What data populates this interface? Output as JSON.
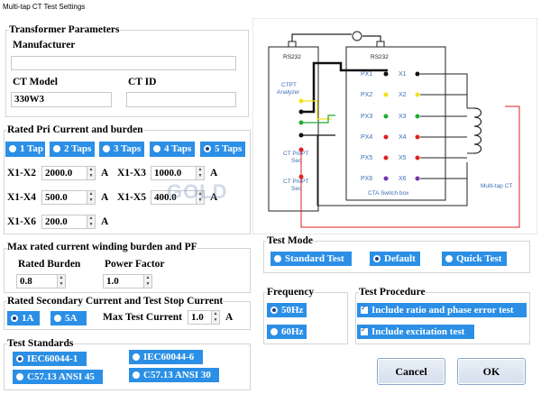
{
  "window": {
    "title": "Multi-tap CT Test Settings"
  },
  "transformer": {
    "title": "Transformer Parameters",
    "manufacturer_label": "Manufacturer",
    "manufacturer_value": "",
    "ct_model_label": "CT Model",
    "ct_model_value": "330W3",
    "ct_id_label": "CT ID",
    "ct_id_value": ""
  },
  "rated_pri": {
    "title": "Rated Pri Current and burden",
    "taps": [
      {
        "label": "1 Tap",
        "selected": false
      },
      {
        "label": "2 Taps",
        "selected": false
      },
      {
        "label": "3 Taps",
        "selected": false
      },
      {
        "label": "4 Taps",
        "selected": false
      },
      {
        "label": "5 Taps",
        "selected": true
      }
    ],
    "fields": [
      {
        "label": "X1-X2",
        "value": "2000.0",
        "unit": "A"
      },
      {
        "label": "X1-X3",
        "value": "1000.0",
        "unit": "A"
      },
      {
        "label": "X1-X4",
        "value": "500.0",
        "unit": "A"
      },
      {
        "label": "X1-X5",
        "value": "400.0",
        "unit": "A"
      },
      {
        "label": "X1-X6",
        "value": "200.0",
        "unit": "A"
      }
    ]
  },
  "winding": {
    "title": "Max rated current winding burden and PF",
    "burden_label": "Rated Burden",
    "burden_value": "0.8",
    "pf_label": "Power Factor",
    "pf_value": "1.0"
  },
  "secondary": {
    "title": "Rated Secondary Current and Test Stop Current",
    "opt1": "1A",
    "opt2": "5A",
    "max_label": "Max Test Current",
    "max_value": "1.0",
    "max_unit": "A"
  },
  "standards": {
    "title": "Test Standards",
    "items": [
      "IEC60044-1",
      "IEC60044-6",
      "C57.13 ANSI 45",
      "C57.13 ANSI 30"
    ],
    "selected": "IEC60044-1"
  },
  "test_mode": {
    "title": "Test Mode",
    "options": [
      "Standard Test",
      "Default",
      "Quick Test"
    ],
    "selected": "Default"
  },
  "frequency": {
    "title": "Frequency",
    "options": [
      "50Hz",
      "60Hz"
    ],
    "selected": "50Hz"
  },
  "procedure": {
    "title": "Test Procedure",
    "items": [
      "Include ratio and phase error test",
      "Include excitation test"
    ]
  },
  "buttons": {
    "cancel": "Cancel",
    "ok": "OK"
  },
  "diagram": {
    "rs232_left": "RS232",
    "rs232_right": "RS232",
    "analyzer_line1": "CTPT",
    "analyzer_line2": "Analyzer",
    "pri_line1": "CT Pri/PT",
    "pri_line2": "Sec",
    "sec_line1": "CT Pri/PT",
    "sec_line2": "Sec",
    "px_labels": [
      "PX1",
      "PX2",
      "PX3",
      "PX4",
      "PX5",
      "PX6"
    ],
    "x_labels": [
      "X1",
      "X2",
      "X3",
      "X4",
      "X5",
      "X6"
    ],
    "switch_box": "CTA Switch box",
    "multitap": "Multi-tap CT",
    "dot_colors": [
      "#111111",
      "#f2e21a",
      "#22aa33",
      "#dd2222",
      "#dd2222",
      "#7733aa"
    ]
  },
  "watermark": "GOLD"
}
